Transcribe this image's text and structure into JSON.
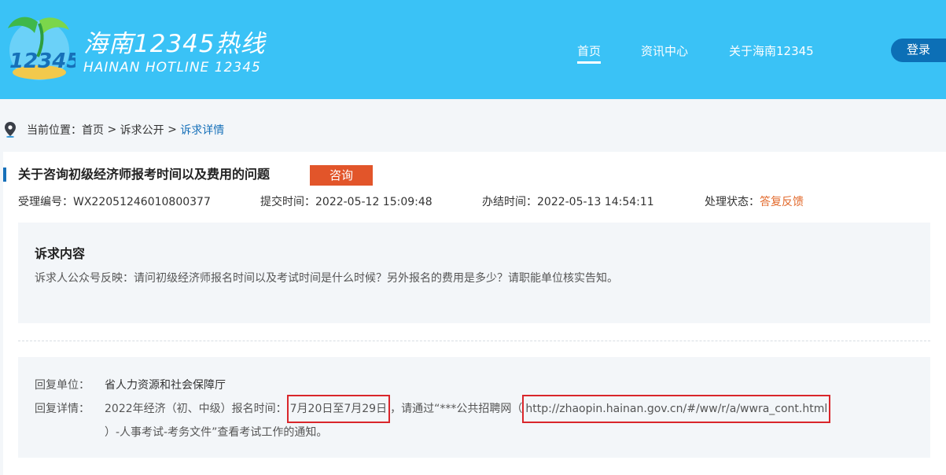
{
  "header": {
    "logo_text": "12345",
    "brand_cn": "海南12345热线",
    "brand_en": "HAINAN HOTLINE 12345",
    "nav": [
      {
        "label": "首页",
        "active": true
      },
      {
        "label": "资讯中心",
        "active": false
      },
      {
        "label": "关于海南12345",
        "active": false
      }
    ],
    "login_label": "登录"
  },
  "breadcrumb": {
    "prefix": "当前位置：",
    "items": [
      "首页",
      "诉求公开"
    ],
    "separator": " > ",
    "current": "诉求详情"
  },
  "detail": {
    "title": "关于咨询初级经济师报考时间以及费用的问题",
    "tag": "咨询",
    "meta": {
      "id_label": "受理编号：",
      "id_value": "WX22051246010800377",
      "submit_label": "提交时间：",
      "submit_value": "2022-05-12 15:09:48",
      "done_label": "办结时间：",
      "done_value": "2022-05-13 14:54:11",
      "status_label": "处理状态：",
      "status_value": "答复反馈"
    },
    "request": {
      "title": "诉求内容",
      "text": "诉求人公众号反映：请问初级经济师报名时间以及考试时间是什么时候？另外报名的费用是多少？请职能单位核实告知。"
    },
    "reply": {
      "unit_label": "回复单位：",
      "unit_value": "省人力资源和社会保障厅",
      "detail_label": "回复详情：",
      "detail_part1": "2022年经济（初、中级）报名时间：",
      "detail_highlight_date": "7月20日至7月29日",
      "detail_part2": "，请通过“***公共招聘网（",
      "detail_highlight_url": "http://zhaopin.hainan.gov.cn/#/ww/r/a/wwra_cont.html",
      "detail_part3": "）-人事考试-考务文件”查看考试工作的通知。"
    }
  },
  "colors": {
    "header_bg": "#3ac2f6",
    "login_bg": "#0c6fb6",
    "accent_blue": "#1670b9",
    "tag_bg": "#e2552a",
    "status": "#e26a2c",
    "highlight_border": "#d9262b"
  }
}
